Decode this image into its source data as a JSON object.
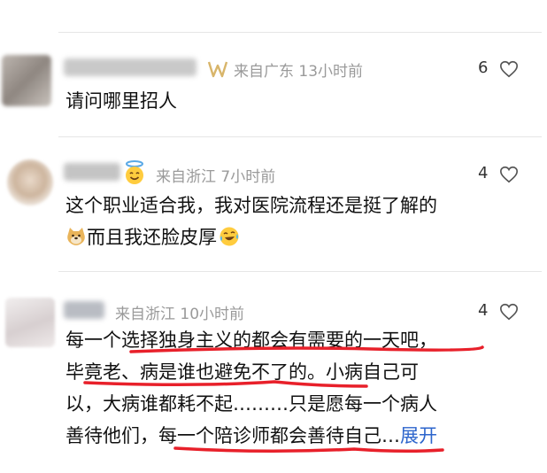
{
  "comments": [
    {
      "location_time": "来自广东 13小时前",
      "likes": "6",
      "lines": [
        "请问哪里招人"
      ]
    },
    {
      "location_time": "来自浙江 7小时前",
      "likes": "4",
      "line1": "这个职业适合我，我对医院流程还是挺了解的",
      "line2": "而且我还脸皮厚"
    },
    {
      "location_time": "来自浙江 10小时前",
      "likes": "4",
      "lines": [
        "每一个选择独身主义的都会有需要的一天吧，",
        "毕竟老、病是谁也避免不了的。小病自己可",
        "以，大病谁都耗不起………只是愿每一个病人"
      ],
      "line4": "善待他们，每一个陪诊师都会善待自己…",
      "expand_label": "展开"
    }
  ],
  "colors": {
    "accent_underline": "#e8202a",
    "expand": "#2d65cc",
    "meta": "#9a9a9a"
  },
  "icons": [
    "heart-outline-icon",
    "vip-badge-icon",
    "halo-smile-emoji",
    "doge-emoji",
    "laugh-cry-emoji"
  ]
}
